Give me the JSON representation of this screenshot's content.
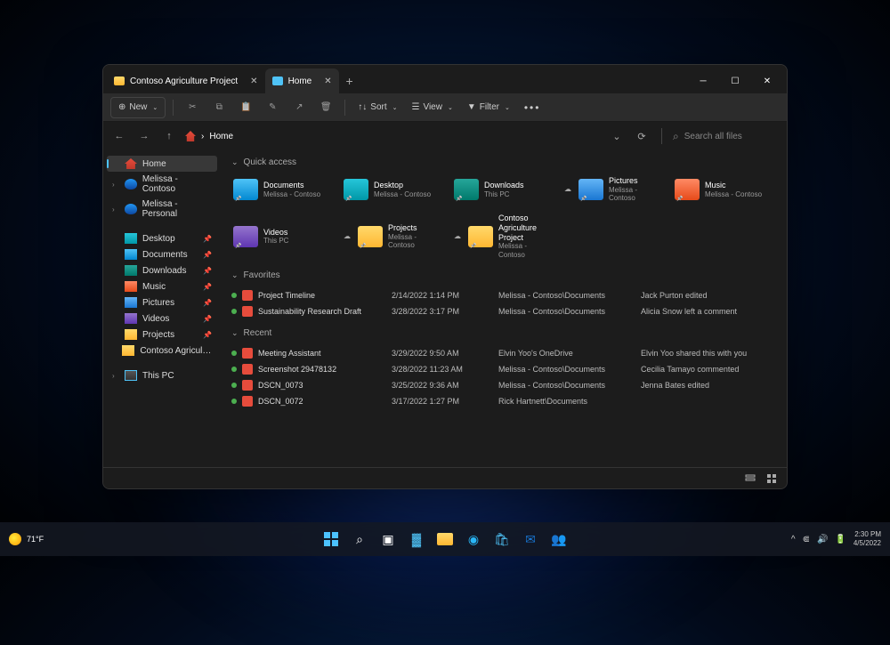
{
  "tabs": [
    {
      "label": "Contoso Agriculture Project",
      "icon_class": "f-yellow"
    },
    {
      "label": "Home",
      "icon_class": "f-blue"
    }
  ],
  "toolbar": {
    "new": "New",
    "sort": "Sort",
    "view": "View",
    "filter": "Filter"
  },
  "breadcrumb": {
    "label": "Home"
  },
  "search": {
    "placeholder": "Search all files"
  },
  "sidebar": {
    "home": "Home",
    "cloud": [
      {
        "label": "Melissa - Contoso"
      },
      {
        "label": "Melissa - Personal"
      }
    ],
    "pinned": [
      {
        "label": "Desktop"
      },
      {
        "label": "Documents"
      },
      {
        "label": "Downloads"
      },
      {
        "label": "Music"
      },
      {
        "label": "Pictures"
      },
      {
        "label": "Videos"
      },
      {
        "label": "Projects"
      },
      {
        "label": "Contoso Agriculture Project"
      }
    ],
    "thispc": "This PC"
  },
  "sections": {
    "quick": "Quick access",
    "favorites": "Favorites",
    "recent": "Recent"
  },
  "quick": [
    {
      "name": "Documents",
      "sub": "Melissa - Contoso",
      "cls": "f-blue",
      "cloud": false
    },
    {
      "name": "Desktop",
      "sub": "Melissa - Contoso",
      "cls": "f-cyan",
      "cloud": false
    },
    {
      "name": "Downloads",
      "sub": "This PC",
      "cls": "f-green",
      "cloud": false
    },
    {
      "name": "Pictures",
      "sub": "Melissa - Contoso",
      "cls": "f-lblue",
      "cloud": true
    },
    {
      "name": "Music",
      "sub": "Melissa - Contoso",
      "cls": "f-orange",
      "cloud": false
    },
    {
      "name": "Videos",
      "sub": "This PC",
      "cls": "f-purple",
      "cloud": false
    },
    {
      "name": "Projects",
      "sub": "Melissa - Contoso",
      "cls": "f-yellow",
      "cloud": true
    },
    {
      "name": "Contoso Agriculture Project",
      "sub": "Melissa - Contoso",
      "cls": "f-yellow",
      "cloud": true
    }
  ],
  "favorites": [
    {
      "name": "Project Timeline",
      "date": "2/14/2022 1:14 PM",
      "loc": "Melissa - Contoso\\Documents",
      "act": "Jack Purton edited"
    },
    {
      "name": "Sustainability Research Draft",
      "date": "3/28/2022 3:17 PM",
      "loc": "Melissa - Contoso\\Documents",
      "act": "Alicia Snow left a comment"
    }
  ],
  "recent": [
    {
      "name": "Meeting Assistant",
      "date": "3/29/2022 9:50 AM",
      "loc": "Elvin Yoo's OneDrive",
      "act": "Elvin Yoo shared this with you"
    },
    {
      "name": "Screenshot 29478132",
      "date": "3/28/2022 11:23 AM",
      "loc": "Melissa - Contoso\\Documents",
      "act": "Cecilia Tamayo commented"
    },
    {
      "name": "DSCN_0073",
      "date": "3/25/2022 9:36 AM",
      "loc": "Melissa - Contoso\\Documents",
      "act": "Jenna Bates edited"
    },
    {
      "name": "DSCN_0072",
      "date": "3/17/2022 1:27 PM",
      "loc": "Rick Hartnett\\Documents",
      "act": ""
    }
  ],
  "taskbar": {
    "temp": "71°F",
    "time": "2:30 PM",
    "date": "4/5/2022"
  }
}
